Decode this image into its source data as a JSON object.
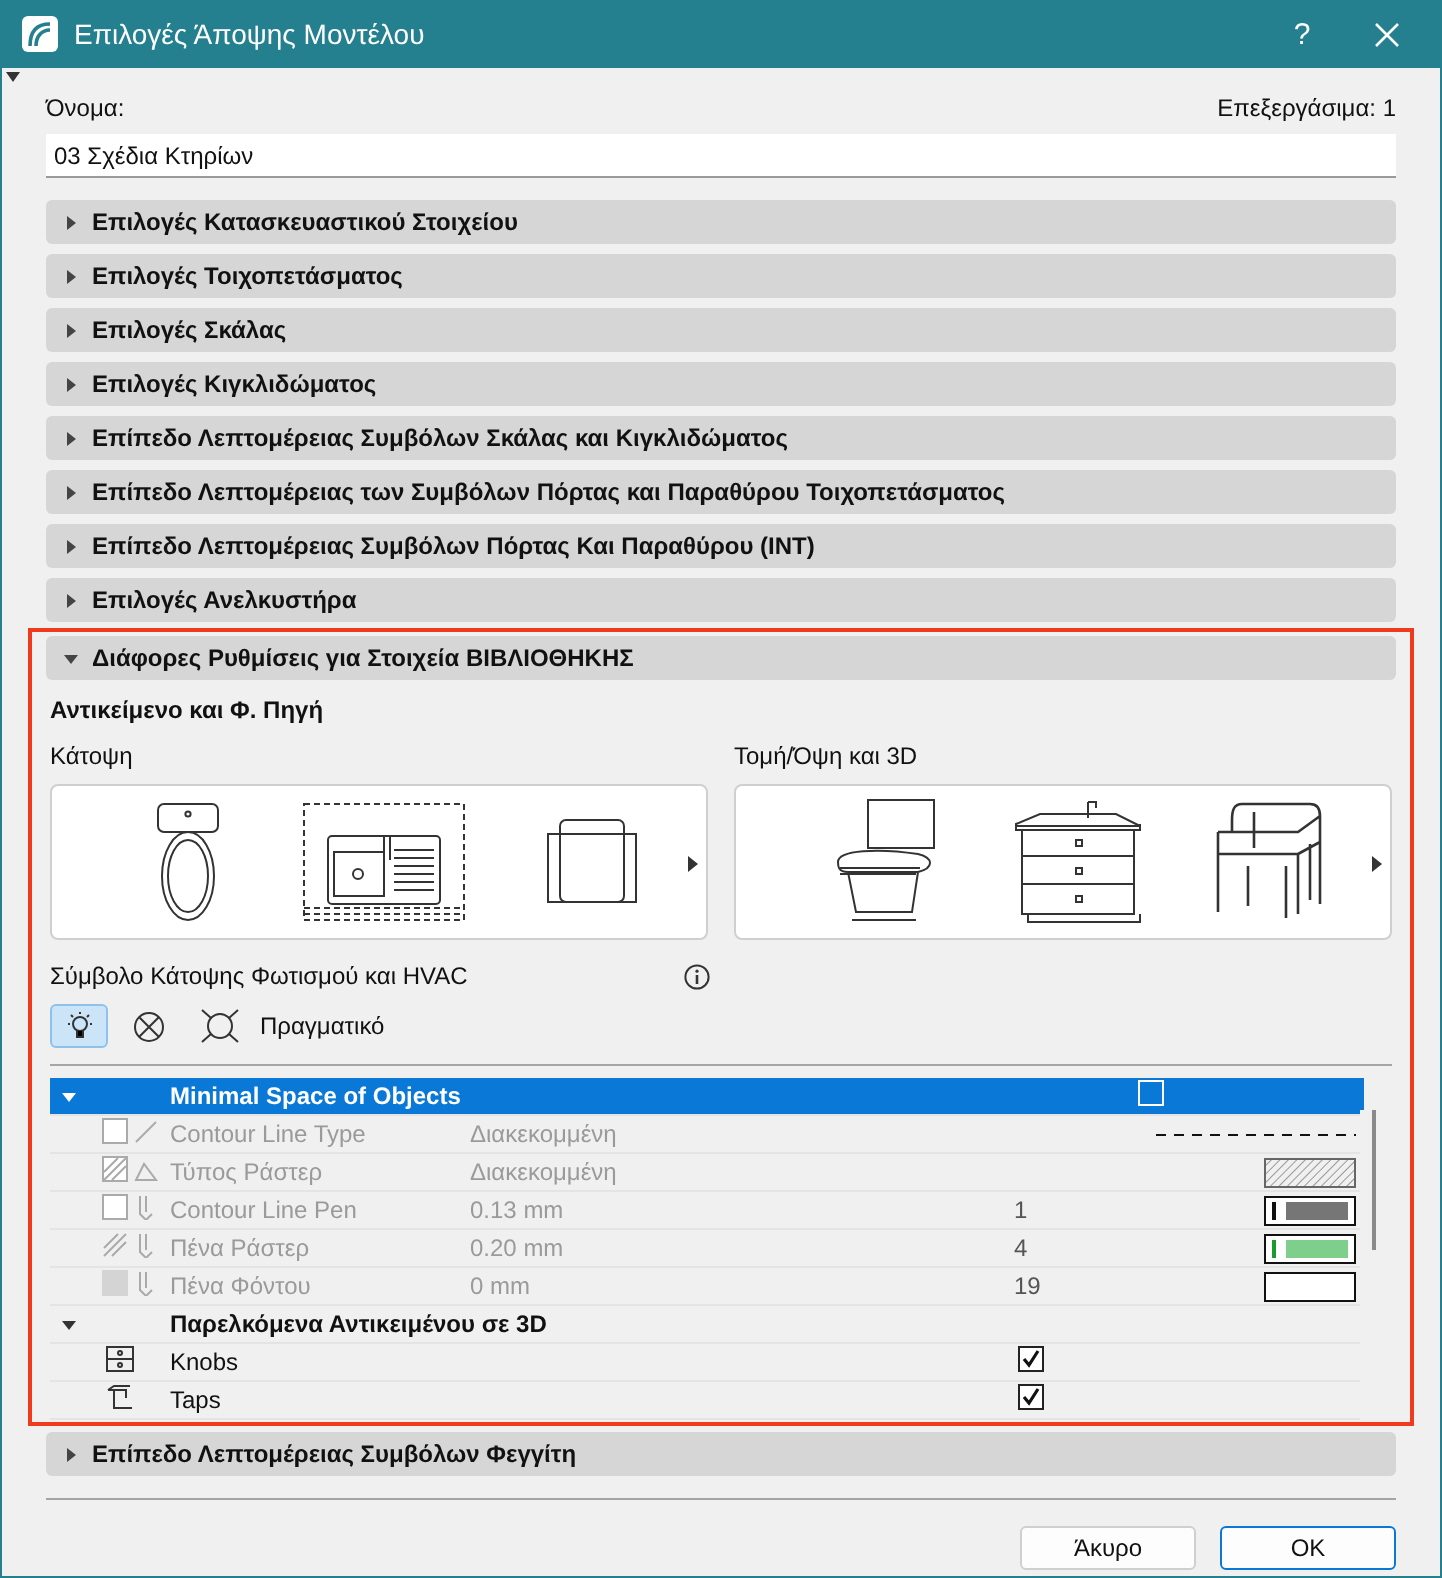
{
  "window": {
    "title": "Επιλογές Άποψης Μοντέλου",
    "help": "?"
  },
  "name_label": "Όνομα:",
  "editable": "Επεξεργάσιμα: 1",
  "name_value": "03 Σχέδια Κτηρίων",
  "sections": [
    {
      "title": "Επιλογές Κατασκευαστικού Στοιχείου",
      "expanded": false
    },
    {
      "title": "Επιλογές Τοιχοπετάσματος",
      "expanded": false
    },
    {
      "title": "Επιλογές Σκάλας",
      "expanded": false
    },
    {
      "title": "Επιλογές Κιγκλιδώματος",
      "expanded": false
    },
    {
      "title": "Επίπεδο Λεπτομέρειας Συμβόλων Σκάλας και Κιγκλιδώματος",
      "expanded": false
    },
    {
      "title": "Επίπεδο Λεπτομέρειας των Συμβόλων Πόρτας και Παραθύρου Τοιχοπετάσματος",
      "expanded": false
    },
    {
      "title": "Επίπεδο Λεπτομέρειας Συμβόλων Πόρτας Και Παραθύρου (INT)",
      "expanded": false
    },
    {
      "title": "Επιλογές Ανελκυστήρα",
      "expanded": false
    },
    {
      "title": "Διάφορες Ρυθμίσεις για Στοιχεία ΒΙΒΛΙΟΘΗΚΗΣ",
      "expanded": true
    },
    {
      "title": "Επίπεδο Λεπτομέρειας Συμβόλων Φεγγίτη",
      "expanded": false
    }
  ],
  "library": {
    "heading": "Αντικείμενο και Φ. Πηγή",
    "plan_label": "Κάτοψη",
    "section_label": "Τομή/Όψη και 3D",
    "lighting_label": "Σύμβολο Κάτοψης Φωτισμού και HVAC",
    "lighting_options": [
      {
        "selected": true
      },
      {
        "selected": false
      },
      {
        "selected": false
      }
    ],
    "lighting_text": "Πραγματικό",
    "rows": [
      {
        "kind": "group",
        "label": "Minimal Space of Objects",
        "expanded": true,
        "selected": true,
        "checked": false
      },
      {
        "kind": "property",
        "label": "Contour Line Type",
        "value": "Διακεκομμένη",
        "preview": {
          "kind": "dashed"
        }
      },
      {
        "kind": "property",
        "label": "Τύπος Ράστερ",
        "value": "Διακεκομμένη",
        "preview": {
          "kind": "hatch"
        }
      },
      {
        "kind": "property",
        "label": "Contour Line Pen",
        "value": "0.13 mm",
        "number": "1",
        "preview": {
          "kind": "pen",
          "color": "#767676"
        }
      },
      {
        "kind": "property",
        "label": "Πένα Ράστερ",
        "value": "0.20 mm",
        "number": "4",
        "preview": {
          "kind": "pen",
          "color": "#7fcf8c"
        }
      },
      {
        "kind": "property",
        "label": "Πένα Φόντου",
        "value": "0 mm",
        "number": "19",
        "preview": {
          "kind": "empty"
        }
      },
      {
        "kind": "group",
        "label": "Παρελκόμενα Αντικειμένου σε 3D",
        "expanded": true,
        "selected": false
      },
      {
        "kind": "item",
        "label": "Knobs",
        "checked": true
      },
      {
        "kind": "item",
        "label": "Taps",
        "checked": true
      }
    ]
  },
  "buttons": [
    {
      "label": "Άκυρο",
      "default": false
    },
    {
      "label": "OK",
      "default": true
    }
  ]
}
